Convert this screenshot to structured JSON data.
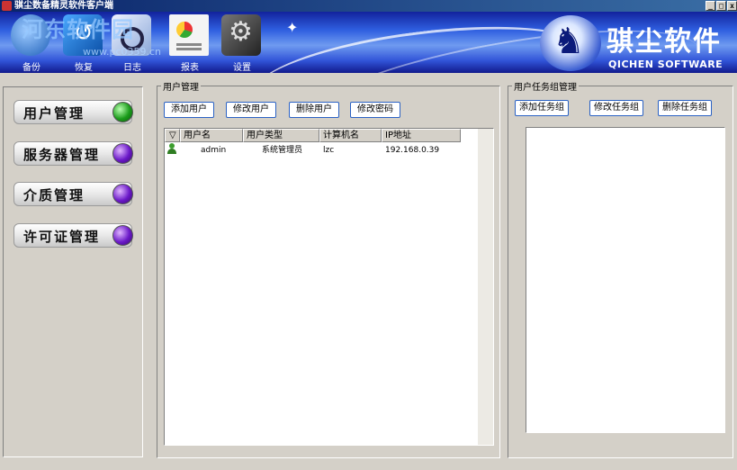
{
  "window": {
    "title": "骐尘数备精灵软件客户端",
    "controls": [
      "_",
      "□",
      "x"
    ]
  },
  "toolbar": {
    "items": [
      {
        "id": "backup",
        "label": "备份",
        "icon": "backup-icon"
      },
      {
        "id": "restore",
        "label": "恢复",
        "icon": "restore-icon"
      },
      {
        "id": "log",
        "label": "日志",
        "icon": "log-icon"
      },
      {
        "id": "report",
        "label": "报表",
        "icon": "report-icon"
      },
      {
        "id": "settings",
        "label": "设置",
        "icon": "gear-icon"
      }
    ]
  },
  "watermark": {
    "text": "河东软件园",
    "url": "www.pc0359.cn"
  },
  "logo": {
    "cn": "骐尘软件",
    "en": "QICHEN SOFTWARE"
  },
  "nav": {
    "items": [
      {
        "label": "用户管理",
        "status": "active",
        "color": "#1b9c1b"
      },
      {
        "label": "服务器管理",
        "status": "inactive",
        "color": "#6a18c8"
      },
      {
        "label": "介质管理",
        "status": "inactive",
        "color": "#6a18c8"
      },
      {
        "label": "许可证管理",
        "status": "inactive",
        "color": "#6a18c8"
      }
    ]
  },
  "user_mgmt": {
    "legend": "用户管理",
    "buttons": {
      "add": "添加用户",
      "edit": "修改用户",
      "delete": "删除用户",
      "password": "修改密码"
    },
    "table": {
      "sort_glyph": "▽",
      "columns": [
        "用户名",
        "用户类型",
        "计算机名",
        "IP地址"
      ],
      "rows": [
        {
          "username": "admin",
          "type": "系统管理员",
          "computer": "lzc",
          "ip": "192.168.0.39"
        }
      ]
    }
  },
  "task_mgmt": {
    "legend": "用户任务组管理",
    "buttons": {
      "add": "添加任务组",
      "edit": "修改任务组",
      "delete": "删除任务组"
    }
  }
}
